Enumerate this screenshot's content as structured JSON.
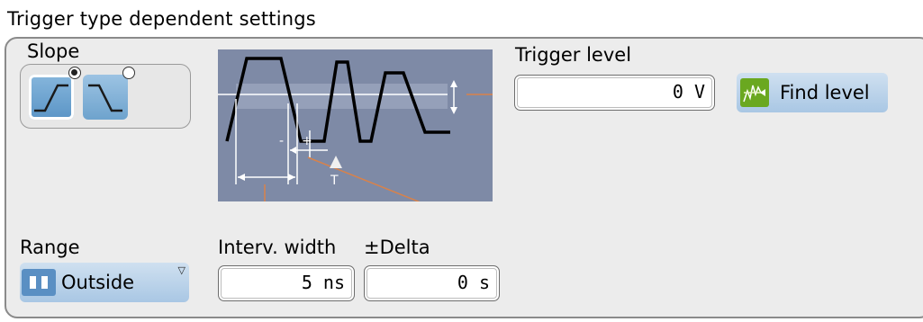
{
  "section": {
    "title": "Trigger type dependent settings"
  },
  "slope": {
    "label": "Slope",
    "options": [
      {
        "name": "rising",
        "icon": "rising-edge-icon",
        "selected": true
      },
      {
        "name": "falling",
        "icon": "falling-edge-icon",
        "selected": false
      }
    ]
  },
  "diagram": {
    "marker_minus": "-",
    "marker_plus": "+",
    "marker_t": "T"
  },
  "trigger_level": {
    "label": "Trigger level",
    "value": "0 V"
  },
  "find_level": {
    "label": "Find level",
    "icon": "find-level-icon"
  },
  "range": {
    "label": "Range",
    "selected": "Outside",
    "icon": "range-outside-icon"
  },
  "interval_width": {
    "label": "Interv. width",
    "value": "5 ns"
  },
  "delta": {
    "label": "±Delta",
    "value": "0 s"
  },
  "colors": {
    "button_blue": "#a9c7e4",
    "diagram_bg": "#7e8aa6",
    "find_icon_green": "#6aa820",
    "slope_line_orange": "#d9824a"
  }
}
